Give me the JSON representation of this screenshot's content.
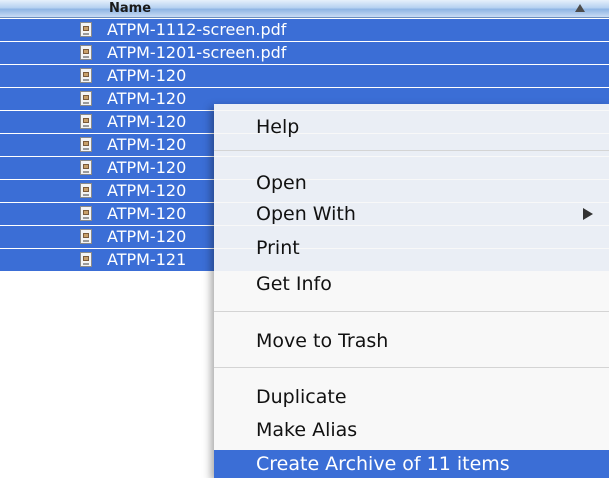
{
  "header": {
    "name_label": "Name"
  },
  "files": [
    "ATPM-1112-screen.pdf",
    "ATPM-1201-screen.pdf",
    "ATPM-120",
    "ATPM-120",
    "ATPM-120",
    "ATPM-120",
    "ATPM-120",
    "ATPM-120",
    "ATPM-120",
    "ATPM-120",
    "ATPM-121"
  ],
  "context_menu": {
    "help": "Help",
    "open": "Open",
    "open_with": "Open With",
    "print": "Print",
    "get_info": "Get Info",
    "move_to_trash": "Move to Trash",
    "duplicate": "Duplicate",
    "make_alias": "Make Alias",
    "create_archive": "Create Archive of 11 items"
  },
  "colors": {
    "selection": "#3b6ed6",
    "menu_background": "#f8f8f8"
  }
}
